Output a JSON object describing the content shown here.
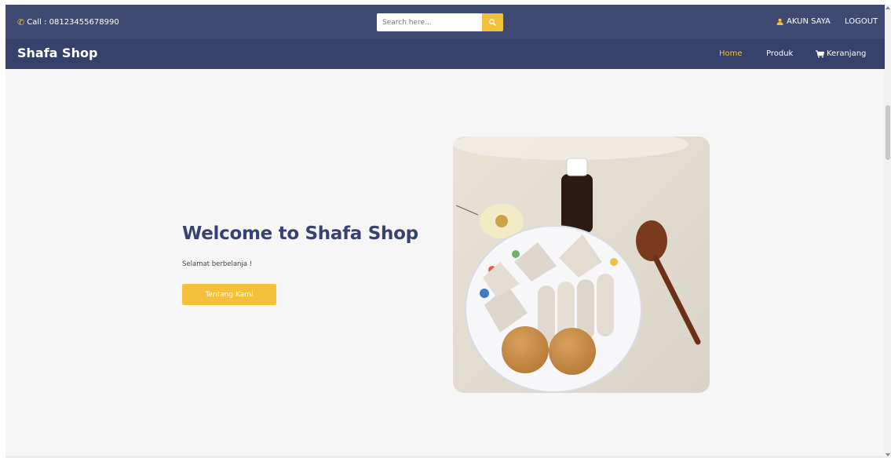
{
  "topbar": {
    "call_text": "Call : 08123455678990",
    "search_placeholder": "Search here...",
    "account_label": "AKUN SAYA",
    "logout_label": "LOGOUT"
  },
  "navbar": {
    "brand": "Shafa Shop",
    "items": [
      {
        "label": "Home"
      },
      {
        "label": "Produk"
      },
      {
        "label": "Keranjang"
      }
    ],
    "active": "Home"
  },
  "hero": {
    "title": "Welcome to Shafa Shop",
    "subtitle": "Selamat berbelanja !",
    "button_label": "Tentang Kami"
  },
  "colors": {
    "topbar_bg": "#3f4a72",
    "navbar_bg": "#35416a",
    "accent": "#f3c03b",
    "title": "#354272",
    "page_bg": "#f6f6f6"
  },
  "icons": {
    "phone": "phone-icon",
    "search": "search-icon",
    "user": "user-icon",
    "cart": "cart-icon"
  }
}
